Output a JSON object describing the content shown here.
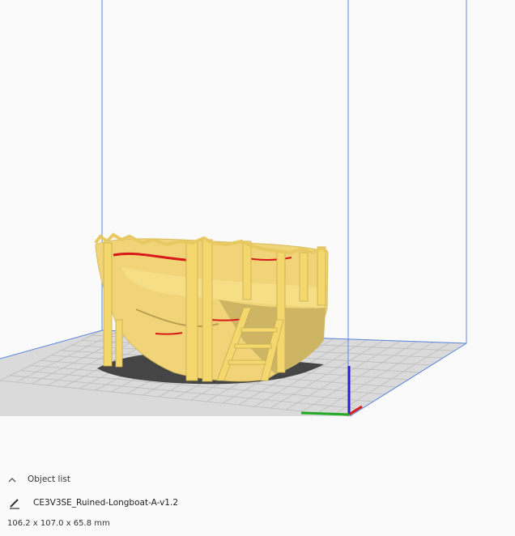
{
  "viewport": {
    "colors": {
      "background": "#fafafa",
      "build_volume_edges": "#4a80d8",
      "build_plate": "#d9d9d9",
      "grid_lines": "#b8b8b8",
      "model_fill": "#f0d276",
      "model_highlight": "#fff0a0",
      "model_shade": "#c9b060",
      "overhang": "#d81a1a",
      "shadow": "#4a4a4a",
      "axis_x": "#d32020",
      "axis_y": "#20b020",
      "axis_z": "#2020d0"
    },
    "model_icon": "ruined-longboat-model"
  },
  "object_list": {
    "header_label": "Object list",
    "expand_icon": "chevron-up-icon",
    "edit_icon": "pencil-icon",
    "object_name": "CE3V3SE_Ruined-Longboat-A-v1.2",
    "dimensions": "106.2 x 107.0 x 65.8 mm"
  }
}
